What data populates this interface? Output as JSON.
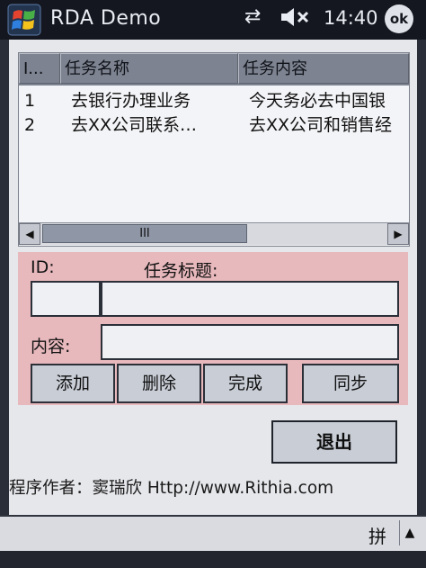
{
  "titlebar": {
    "title": "RDA Demo",
    "time": "14:40",
    "ok_label": "ok",
    "icons": [
      "windows-start-icon",
      "connectivity-icon",
      "speaker-muted-icon"
    ]
  },
  "listview": {
    "columns": [
      "I...",
      "任务名称",
      "任务内容"
    ],
    "rows": [
      {
        "id": "1",
        "name": "去银行办理业务",
        "content": "今天务必去中国银"
      },
      {
        "id": "2",
        "name": "去XX公司联系…",
        "content": "去XX公司和销售经"
      }
    ],
    "scroll": {
      "left_arrow": "◀",
      "right_arrow": "▶",
      "thumb_grip": "III"
    }
  },
  "form": {
    "id_label": "ID:",
    "title_label": "任务标题:",
    "content_label": "内容:",
    "id_value": "",
    "title_value": "",
    "content_value": "",
    "buttons": {
      "add": "添加",
      "delete": "删除",
      "complete": "完成",
      "sync": "同步",
      "exit": "退出"
    }
  },
  "footer": {
    "author": "程序作者：窦瑞欣 Http://www.Rithia.com"
  },
  "sip": {
    "label": "拼",
    "arrow": "▲"
  }
}
